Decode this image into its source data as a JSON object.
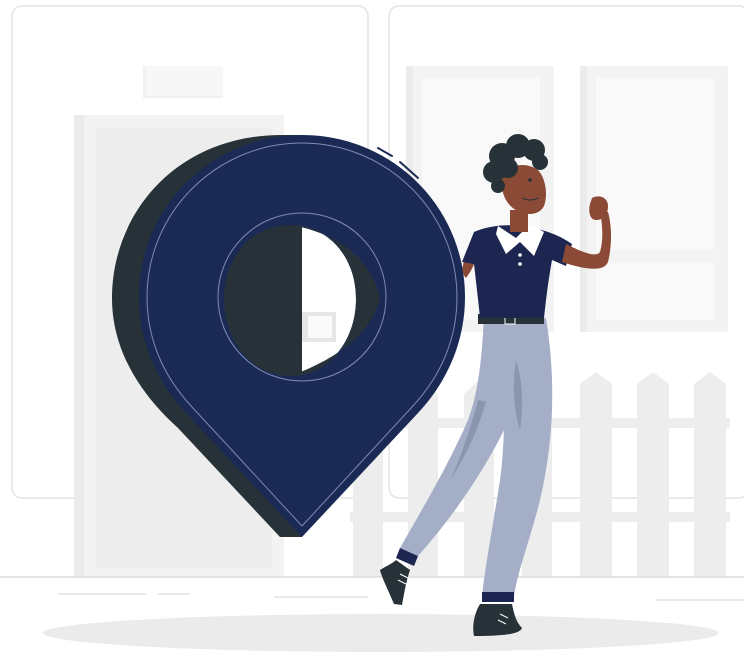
{
  "illustration": {
    "subject": "person-with-location-pin",
    "colors": {
      "background": "#ffffff",
      "wall_stroke": "#e3e3e3",
      "panel_light": "#f3f3f3",
      "panel_mid": "#ebebeb",
      "pin_blue": "#1b2a55",
      "pin_shadow": "#263238",
      "pin_outline": "#7d8bb3",
      "shirt_navy": "#1d2650",
      "collar_white": "#ffffff",
      "pants_blue": "#a4aec7",
      "pants_shade": "#8b95b0",
      "skin": "#8b4a35",
      "hair": "#263238",
      "shoe": "#263238",
      "ground_shadow": "#ebebeb",
      "floor_line": "#dedede"
    }
  }
}
